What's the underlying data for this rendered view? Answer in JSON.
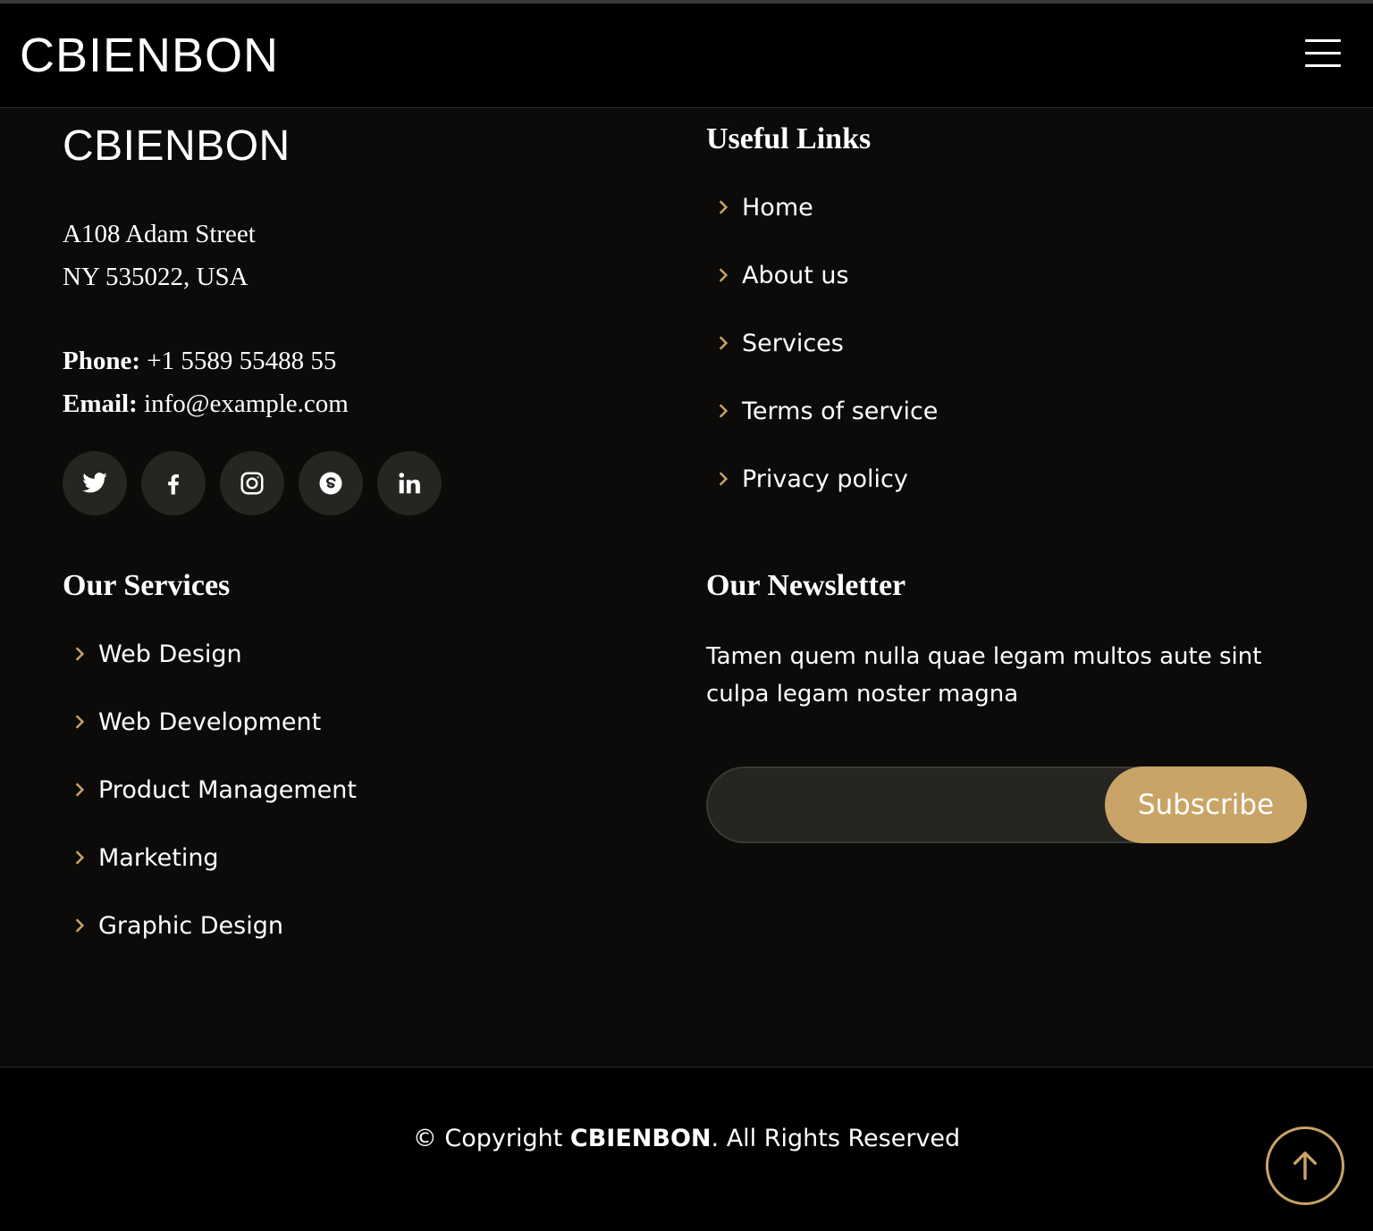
{
  "header": {
    "logo": "CBIENBON",
    "menu_icon": "hamburger-menu-icon"
  },
  "about": {
    "logo": "CBIENBON",
    "address_line1": "A108 Adam Street",
    "address_line2": "NY 535022, USA",
    "phone_label": "Phone:",
    "phone_value": "+1 5589 55488 55",
    "email_label": "Email:",
    "email_value": "info@example.com",
    "socials": [
      "twitter-icon",
      "facebook-icon",
      "instagram-icon",
      "skype-icon",
      "linkedin-icon"
    ]
  },
  "useful_links": {
    "title": "Useful Links",
    "items": [
      "Home",
      "About us",
      "Services",
      "Terms of service",
      "Privacy policy"
    ]
  },
  "services": {
    "title": "Our Services",
    "items": [
      "Web Design",
      "Web Development",
      "Product Management",
      "Marketing",
      "Graphic Design"
    ]
  },
  "newsletter": {
    "title": "Our Newsletter",
    "text": "Tamen quem nulla quae legam multos aute sint culpa legam noster magna",
    "input_value": "",
    "button_label": "Subscribe"
  },
  "footer": {
    "copyright_prefix": "© Copyright ",
    "copyright_brand": "CBIENBON",
    "copyright_suffix": ". All Rights Reserved"
  },
  "colors": {
    "accent": "#c9a466",
    "background": "#0c0b09",
    "bar": "#000000",
    "social_bg": "#262521"
  }
}
